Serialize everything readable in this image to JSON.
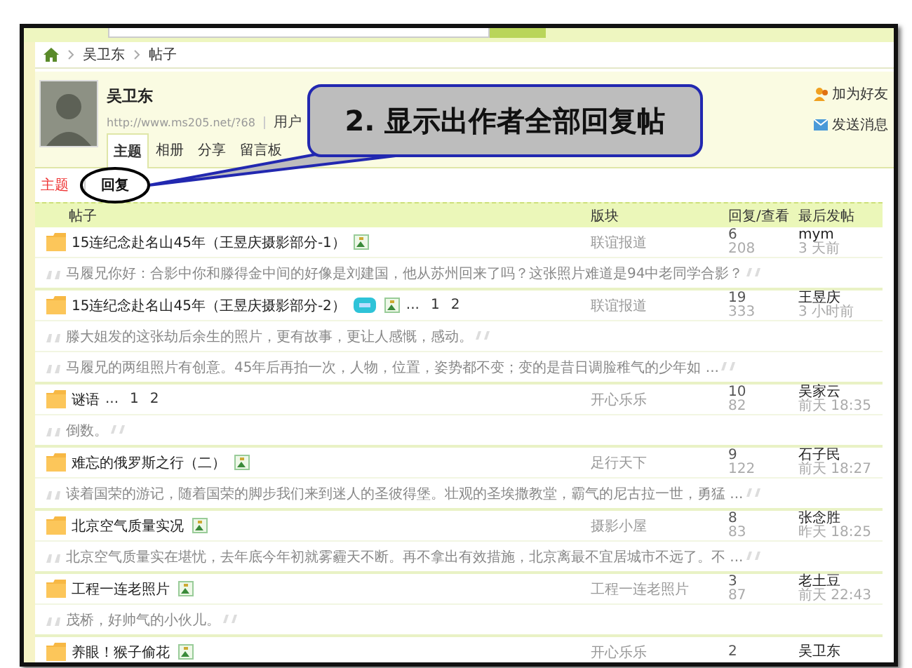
{
  "breadcrumb": [
    {
      "label": "吴卫东"
    },
    {
      "label": "帖子"
    }
  ],
  "profile": {
    "name": "吴卫东",
    "url": "http://www.ms205.net/?68",
    "url_note": "用户",
    "actions": [
      {
        "kind": "friend",
        "label": "加为好友"
      },
      {
        "kind": "message",
        "label": "发送消息"
      }
    ]
  },
  "tabs": [
    {
      "label": "主题",
      "selected": true
    },
    {
      "label": "相册",
      "selected": false
    },
    {
      "label": "分享",
      "selected": false
    },
    {
      "label": "留言板",
      "selected": false
    }
  ],
  "subnav": [
    {
      "label": "主题",
      "selected": false
    },
    {
      "label": "回复",
      "selected": true
    }
  ],
  "callout": {
    "text": "2. 显示出作者全部回复帖"
  },
  "table": {
    "columns": [
      "帖子",
      "版块",
      "回复/查看",
      "最后发帖"
    ],
    "rows": [
      {
        "title": "15连纪念赴名山45年（王昱庆摄影部分-1）",
        "badges": [
          {
            "kind": "image"
          }
        ],
        "board": "联谊报道",
        "replies": "6",
        "views": "208",
        "last_user": "mym",
        "last_time": "3 天前",
        "quotes": [
          "马履兄你好：合影中你和滕得金中间的好像是刘建国，他从苏州回来了吗？这张照片难道是94中老同学合影？"
        ]
      },
      {
        "title": "15连纪念赴名山45年（王昱庆摄影部分-2）",
        "badges": [
          {
            "kind": "digest"
          },
          {
            "kind": "image"
          }
        ],
        "pages": {
          "ellipsis": "...",
          "links": [
            "1",
            "2"
          ]
        },
        "board": "联谊报道",
        "replies": "19",
        "views": "333",
        "last_user": "王昱庆",
        "last_time": "3 小时前",
        "quotes": [
          "滕大姐发的这张劫后余生的照片，更有故事，更让人感慨，感动。",
          "马履兄的两组照片有创意。45年后再拍一次，人物，位置，姿势都不变；变的是昔日调脸稚气的少年如 ..."
        ]
      },
      {
        "title": "谜语",
        "pages": {
          "ellipsis": "...",
          "links": [
            "1",
            "2"
          ]
        },
        "board": "开心乐乐",
        "replies": "10",
        "views": "82",
        "last_user": "吴家云",
        "last_time": "前天 18:35",
        "quotes": [
          "倒数。"
        ]
      },
      {
        "title": "难忘的俄罗斯之行（二）",
        "badges": [
          {
            "kind": "image"
          }
        ],
        "board": "足行天下",
        "replies": "9",
        "views": "122",
        "last_user": "石子民",
        "last_time": "前天 18:27",
        "quotes": [
          "读着国荣的游记，随着国荣的脚步我们来到迷人的圣彼得堡。壮观的圣埃撒教堂，霸气的尼古拉一世，勇猛 ..."
        ]
      },
      {
        "title": "北京空气质量实况",
        "badges": [
          {
            "kind": "image"
          }
        ],
        "board": "摄影小屋",
        "replies": "8",
        "views": "83",
        "last_user": "张念胜",
        "last_time": "昨天 18:25",
        "quotes": [
          "北京空气质量实在堪忧，去年底今年初就雾霾天不断。再不拿出有效措施，北京离最不宜居城市不远了。不 ..."
        ]
      },
      {
        "title": "工程一连老照片",
        "badges": [
          {
            "kind": "image"
          }
        ],
        "board": "工程一连老照片",
        "replies": "3",
        "views": "87",
        "last_user": "老土豆",
        "last_time": "前天 22:43",
        "quotes": [
          "茂桥，好帅气的小伙儿。"
        ]
      },
      {
        "title": "养眼！猴子偷花",
        "badges": [
          {
            "kind": "image"
          }
        ],
        "board": "开心乐乐",
        "replies": "2",
        "last_user": "吴卫东",
        "quotes": []
      }
    ]
  }
}
